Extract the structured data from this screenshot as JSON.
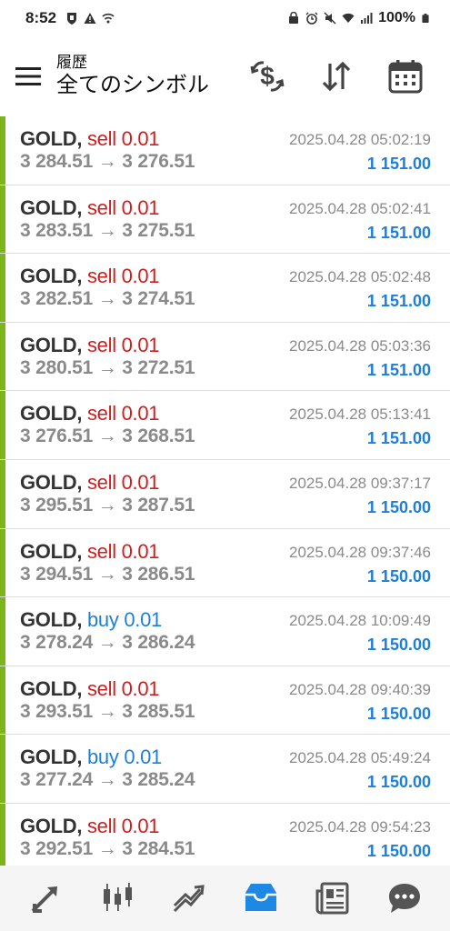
{
  "status": {
    "time": "8:52",
    "battery": "100%"
  },
  "header": {
    "subtitle": "履歴",
    "title": "全てのシンボル"
  },
  "colors": {
    "accent_green": "#7cb518",
    "sell": "#cc1f1f",
    "buy": "#1e7fd6",
    "nav_active": "#1e88e5"
  },
  "icons": {
    "menu": "hamburger-icon",
    "currency": "currency-exchange-icon",
    "sort": "sort-icon",
    "calendar": "calendar-icon",
    "nav": [
      "quotes-icon",
      "chart-icon",
      "trade-icon",
      "history-icon",
      "news-icon",
      "chat-icon"
    ]
  },
  "trades": [
    {
      "symbol": "GOLD,",
      "side": "sell 0.01",
      "type": "sell",
      "prices": "3 284.51 → 3 276.51",
      "time": "2025.04.28 05:02:19",
      "profit": "1 151.00"
    },
    {
      "symbol": "GOLD,",
      "side": "sell 0.01",
      "type": "sell",
      "prices": "3 283.51 → 3 275.51",
      "time": "2025.04.28 05:02:41",
      "profit": "1 151.00"
    },
    {
      "symbol": "GOLD,",
      "side": "sell 0.01",
      "type": "sell",
      "prices": "3 282.51 → 3 274.51",
      "time": "2025.04.28 05:02:48",
      "profit": "1 151.00"
    },
    {
      "symbol": "GOLD,",
      "side": "sell 0.01",
      "type": "sell",
      "prices": "3 280.51 → 3 272.51",
      "time": "2025.04.28 05:03:36",
      "profit": "1 151.00"
    },
    {
      "symbol": "GOLD,",
      "side": "sell 0.01",
      "type": "sell",
      "prices": "3 276.51 → 3 268.51",
      "time": "2025.04.28 05:13:41",
      "profit": "1 151.00"
    },
    {
      "symbol": "GOLD,",
      "side": "sell 0.01",
      "type": "sell",
      "prices": "3 295.51 → 3 287.51",
      "time": "2025.04.28 09:37:17",
      "profit": "1 150.00"
    },
    {
      "symbol": "GOLD,",
      "side": "sell 0.01",
      "type": "sell",
      "prices": "3 294.51 → 3 286.51",
      "time": "2025.04.28 09:37:46",
      "profit": "1 150.00"
    },
    {
      "symbol": "GOLD,",
      "side": "buy 0.01",
      "type": "buy",
      "prices": "3 278.24 → 3 286.24",
      "time": "2025.04.28 10:09:49",
      "profit": "1 150.00"
    },
    {
      "symbol": "GOLD,",
      "side": "sell 0.01",
      "type": "sell",
      "prices": "3 293.51 → 3 285.51",
      "time": "2025.04.28 09:40:39",
      "profit": "1 150.00"
    },
    {
      "symbol": "GOLD,",
      "side": "buy 0.01",
      "type": "buy",
      "prices": "3 277.24 → 3 285.24",
      "time": "2025.04.28 05:49:24",
      "profit": "1 150.00"
    },
    {
      "symbol": "GOLD,",
      "side": "sell 0.01",
      "type": "sell",
      "prices": "3 292.51 → 3 284.51",
      "time": "2025.04.28 09:54:23",
      "profit": "1 150.00"
    }
  ]
}
